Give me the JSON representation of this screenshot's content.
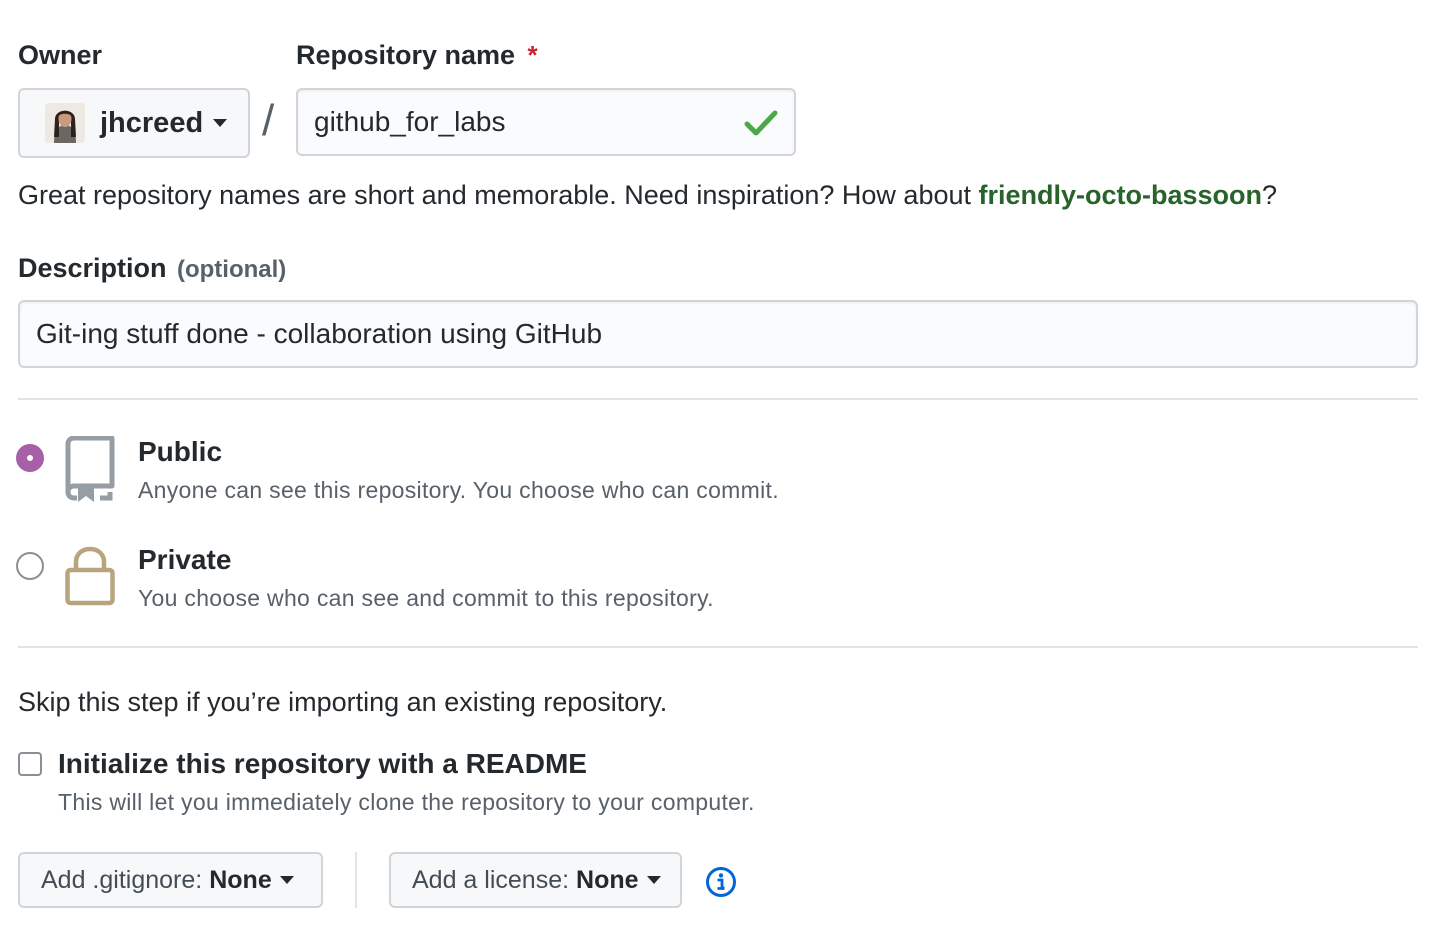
{
  "owner": {
    "label": "Owner",
    "username": "jhcreed"
  },
  "repo_name": {
    "label": "Repository name",
    "required_mark": "*",
    "value": "github_for_labs"
  },
  "separator": "/",
  "hint": {
    "prefix": "Great repository names are short and memorable. Need inspiration? How about ",
    "suggestion": "friendly-octo-bassoon",
    "suffix": "?"
  },
  "description": {
    "label": "Description",
    "optional": "(optional)",
    "value": "Git-ing stuff done - collaboration using GitHub"
  },
  "visibility": {
    "public": {
      "title": "Public",
      "note": "Anyone can see this repository. You choose who can commit.",
      "checked": true
    },
    "private": {
      "title": "Private",
      "note": "You choose who can see and commit to this repository.",
      "checked": false
    }
  },
  "import_note": "Skip this step if you’re importing an existing repository.",
  "readme": {
    "title": "Initialize this repository with a README",
    "note": "This will let you immediately clone the repository to your computer.",
    "checked": false
  },
  "gitignore": {
    "label": "Add .gitignore:",
    "value": "None"
  },
  "license": {
    "label": "Add a license:",
    "value": "None"
  },
  "colors": {
    "accent_radio": "#a760a8",
    "success_check": "#4ca747",
    "suggestion_link": "#28632c",
    "required": "#cb2431",
    "info_icon": "#0366d6",
    "repo_icon": "#959da5",
    "lock_icon": "#b8a47d"
  },
  "icons": [
    "check-icon",
    "repo-icon",
    "lock-icon",
    "info-icon",
    "caret-down-icon"
  ]
}
